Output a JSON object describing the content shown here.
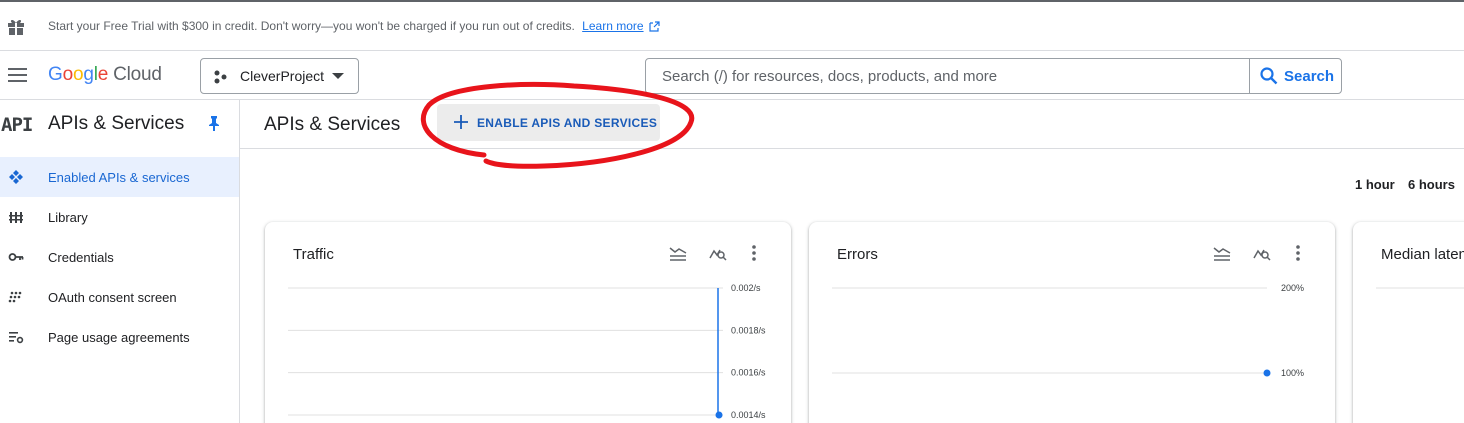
{
  "banner": {
    "text": "Start your Free Trial with $300 in credit. Don't worry—you won't be charged if you run out of credits.",
    "link": "Learn more"
  },
  "header": {
    "logo": {
      "google": "Google",
      "cloud": "Cloud"
    },
    "project": "CleverProject",
    "search_placeholder": "Search (/) for resources, docs, products, and more",
    "search_button": "Search"
  },
  "sidebar": {
    "badge": "API",
    "title": "APIs & Services",
    "items": [
      {
        "label": "Enabled APIs & services",
        "icon": "enabled-apis-icon",
        "active": true
      },
      {
        "label": "Library",
        "icon": "library-icon",
        "active": false
      },
      {
        "label": "Credentials",
        "icon": "key-icon",
        "active": false
      },
      {
        "label": "OAuth consent screen",
        "icon": "oauth-icon",
        "active": false
      },
      {
        "label": "Page usage agreements",
        "icon": "agreements-icon",
        "active": false
      }
    ]
  },
  "main": {
    "title": "APIs & Services",
    "enable_button": "ENABLE APIS AND SERVICES",
    "time_ranges": [
      "1 hour",
      "6 hours"
    ]
  },
  "cards": [
    {
      "title": "Traffic"
    },
    {
      "title": "Errors"
    },
    {
      "title": "Median laten"
    }
  ],
  "chart_data": [
    {
      "type": "line",
      "title": "Traffic",
      "y_ticks": [
        "0.002/s",
        "0.0018/s",
        "0.0016/s",
        "0.0014/s"
      ],
      "ylim": [
        0.0014,
        0.002
      ],
      "series": [
        {
          "values": [
            0.002,
            0.0014
          ]
        }
      ],
      "grid": true
    },
    {
      "type": "line",
      "title": "Errors",
      "y_ticks": [
        "200%",
        "100%"
      ],
      "ylim": [
        100,
        200
      ],
      "series": [
        {
          "values": [
            100
          ]
        }
      ],
      "grid": true
    }
  ],
  "colors": {
    "accent": "#1a73e8",
    "annotation": "#e8141b",
    "active_bg": "#e8f0fe"
  }
}
